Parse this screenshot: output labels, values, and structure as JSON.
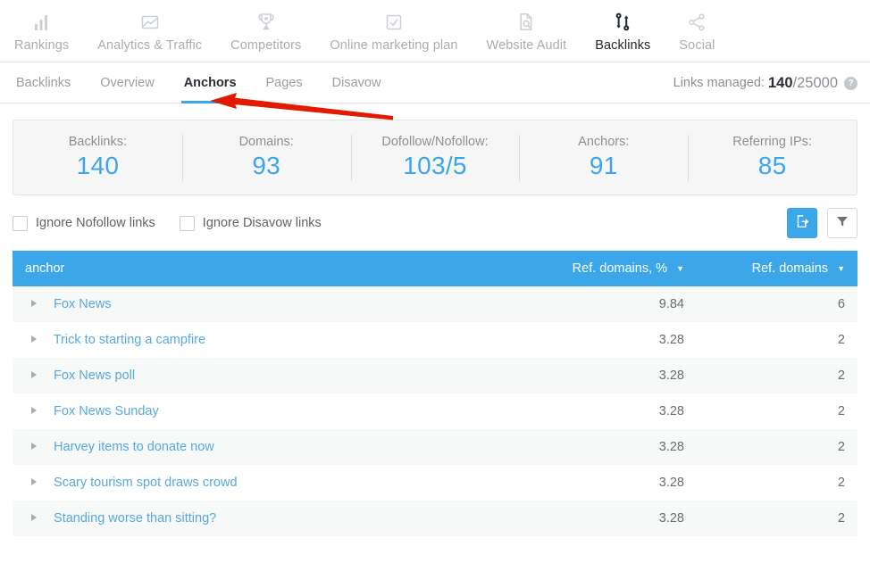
{
  "topnav": {
    "items": [
      {
        "label": "Rankings",
        "icon": "bar-chart-icon",
        "active": false
      },
      {
        "label": "Analytics & Traffic",
        "icon": "area-chart-icon",
        "active": false
      },
      {
        "label": "Competitors",
        "icon": "trophy-icon",
        "active": false
      },
      {
        "label": "Online marketing plan",
        "icon": "checkbox-task-icon",
        "active": false
      },
      {
        "label": "Website Audit",
        "icon": "document-search-icon",
        "active": false
      },
      {
        "label": "Backlinks",
        "icon": "link-branch-icon",
        "active": true
      },
      {
        "label": "Social",
        "icon": "share-nodes-icon",
        "active": false
      }
    ]
  },
  "subnav": {
    "tabs": [
      {
        "label": "Backlinks",
        "active": false
      },
      {
        "label": "Overview",
        "active": false
      },
      {
        "label": "Anchors",
        "active": true
      },
      {
        "label": "Pages",
        "active": false
      },
      {
        "label": "Disavow",
        "active": false
      }
    ],
    "links_managed": {
      "label": "Links managed:",
      "used": "140",
      "total": "/25000",
      "help_icon": "question-mark-icon"
    }
  },
  "stats": [
    {
      "label": "Backlinks:",
      "value": "140"
    },
    {
      "label": "Domains:",
      "value": "93"
    },
    {
      "label": "Dofollow/Nofollow:",
      "value": "103/5"
    },
    {
      "label": "Anchors:",
      "value": "91"
    },
    {
      "label": "Referring IPs:",
      "value": "85"
    }
  ],
  "filterbar": {
    "checkboxes": [
      {
        "label": "Ignore Nofollow links",
        "checked": false
      },
      {
        "label": "Ignore Disavow links",
        "checked": false
      }
    ],
    "buttons": [
      {
        "name": "export-button",
        "icon": "export-icon",
        "style": "primary"
      },
      {
        "name": "filter-button",
        "icon": "funnel-icon",
        "style": "ghost"
      }
    ]
  },
  "table": {
    "columns": [
      {
        "key": "anchor",
        "label": "anchor",
        "align": "left",
        "sortable": true,
        "sort_caret": false
      },
      {
        "key": "pct",
        "label": "Ref. domains, %",
        "align": "right",
        "sortable": true,
        "sort_caret": true
      },
      {
        "key": "dom",
        "label": "Ref. domains",
        "align": "right",
        "sortable": true,
        "sort_caret": true
      }
    ],
    "caret_glyph": "▼",
    "rows": [
      {
        "anchor": "Fox News",
        "pct": "9.84",
        "dom": "6"
      },
      {
        "anchor": "Trick to starting a campfire",
        "pct": "3.28",
        "dom": "2"
      },
      {
        "anchor": "Fox News poll",
        "pct": "3.28",
        "dom": "2"
      },
      {
        "anchor": "Fox News Sunday",
        "pct": "3.28",
        "dom": "2"
      },
      {
        "anchor": "Harvey items to donate now",
        "pct": "3.28",
        "dom": "2"
      },
      {
        "anchor": "Scary tourism spot draws crowd",
        "pct": "3.28",
        "dom": "2"
      },
      {
        "anchor": "Standing worse than sitting?",
        "pct": "3.28",
        "dom": "2"
      }
    ]
  },
  "annotation": {
    "type": "arrow",
    "color": "#e01b00",
    "points_at": "Anchors"
  },
  "colors": {
    "accent_blue": "#3ba7e8",
    "link_blue": "#57a9e0",
    "panel_bg": "#f6f6f6",
    "row_alt_bg": "#f7f8f8",
    "text_gray": "#6a6f74",
    "label_gray": "#8b9096",
    "annotation_red": "#e01b00"
  }
}
